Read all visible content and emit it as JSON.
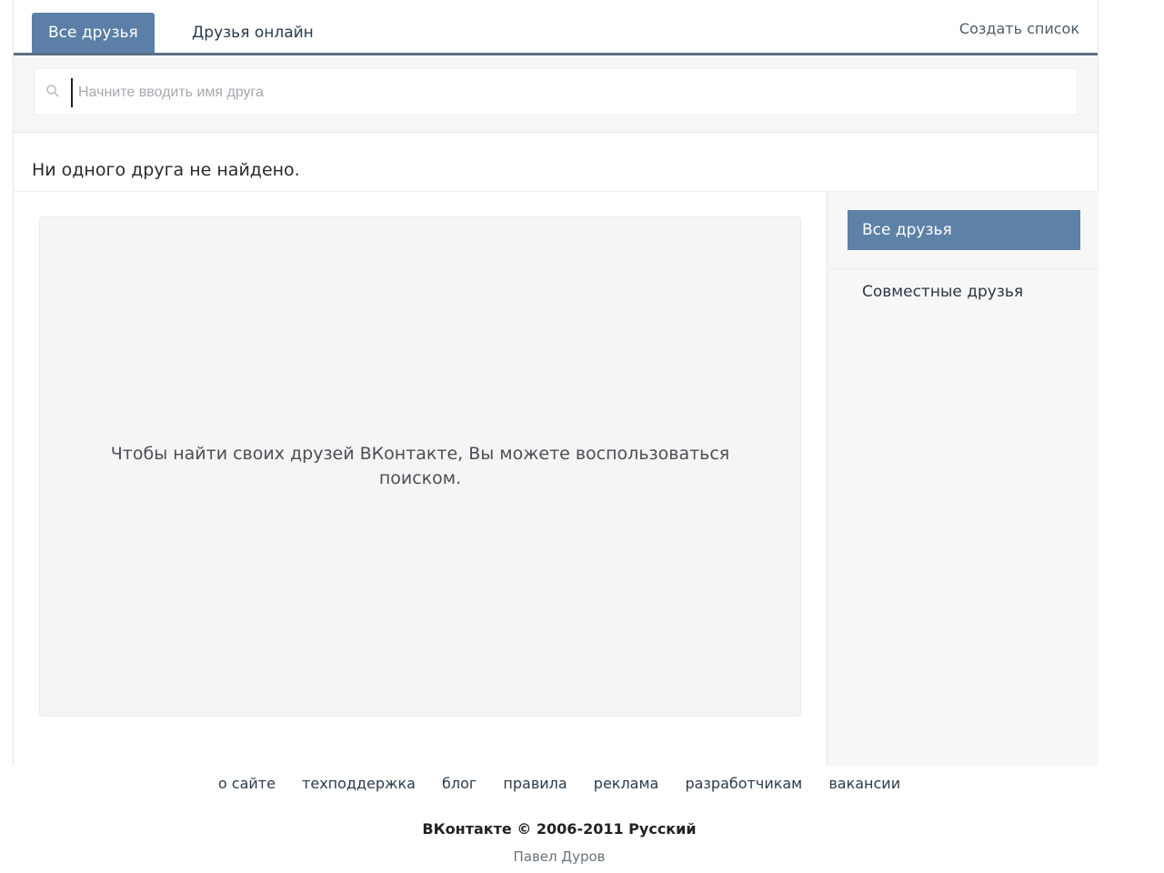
{
  "tabs": {
    "all_friends": "Все друзья",
    "friends_online": "Друзья онлайн",
    "create_list": "Создать список"
  },
  "search": {
    "placeholder": "Начните вводить имя друга",
    "value": ""
  },
  "status": {
    "not_found": "Ни одного друга не найдено."
  },
  "empty_state": {
    "message": "Чтобы найти своих друзей ВКонтакте, Вы можете воспользоваться поиском."
  },
  "sidebar": {
    "items": [
      {
        "label": "Все друзья",
        "active": true
      },
      {
        "label": "Совместные друзья",
        "active": false
      }
    ]
  },
  "footer": {
    "links": [
      "о сайте",
      "техподдержка",
      "блог",
      "правила",
      "реклама",
      "разработчикам",
      "вакансии"
    ],
    "copyright": "ВКонтакте © 2006-2011 Русский",
    "author": "Павел Дуров"
  },
  "colors": {
    "accent": "#5b7fa6",
    "tab_border": "#5d6f82",
    "panel_bg": "#f5f5f6"
  },
  "icons": {
    "search": "search-icon"
  }
}
